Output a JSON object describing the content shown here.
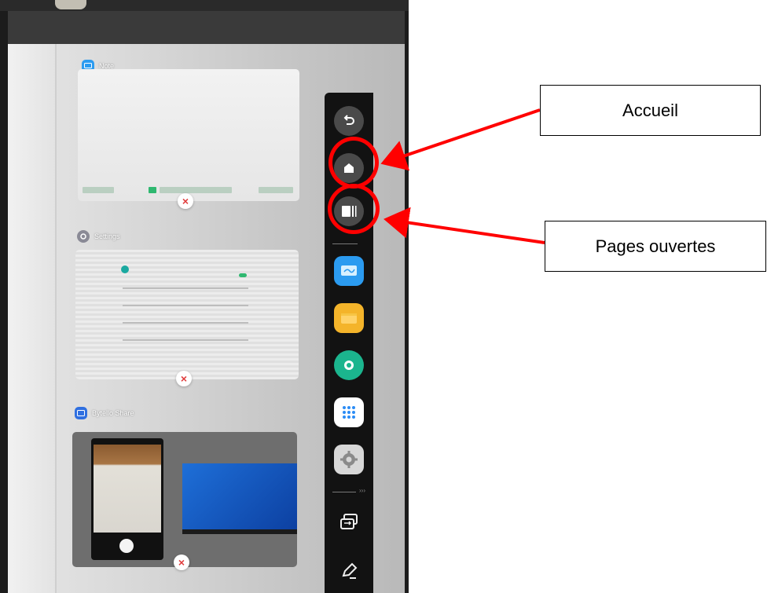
{
  "cards": {
    "note": {
      "title": "Note",
      "close_glyph": "×"
    },
    "settings": {
      "title": "Settings",
      "close_glyph": "×"
    },
    "share": {
      "title": "Bytello Share",
      "close_glyph": "×"
    }
  },
  "sidebar": {
    "items": [
      {
        "name": "back-icon"
      },
      {
        "name": "home-icon"
      },
      {
        "name": "open-pages-icon"
      },
      {
        "name": "whiteboard-app-icon",
        "color": "#2b9bf0"
      },
      {
        "name": "folder-app-icon",
        "color": "#f4b42a"
      },
      {
        "name": "record-app-icon",
        "color": "#1bb58e"
      },
      {
        "name": "apps-grid-icon",
        "color": "#2b8cf5"
      },
      {
        "name": "settings-gear-icon"
      },
      {
        "name": "screen-share-icon"
      },
      {
        "name": "pen-icon"
      }
    ],
    "divider_arrows": "›››"
  },
  "annotations": {
    "accueil": "Accueil",
    "pages_ouvertes": "Pages ouvertes",
    "color": "#ff0000"
  }
}
